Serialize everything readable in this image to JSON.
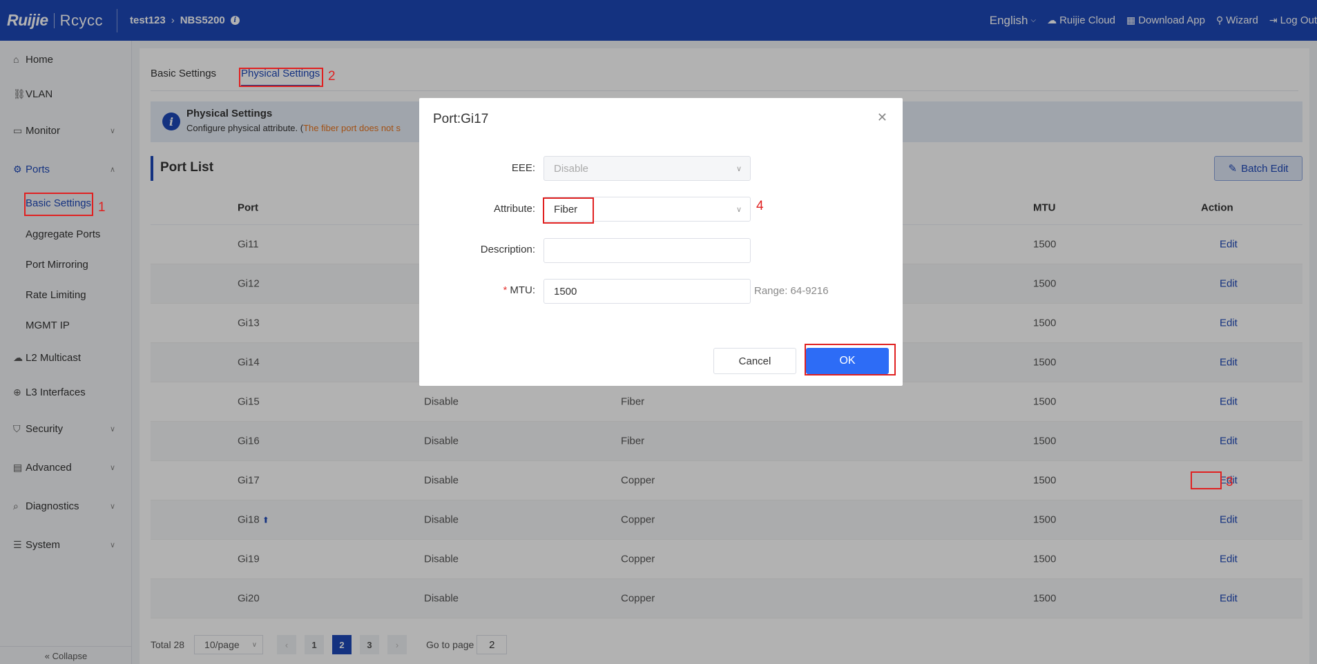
{
  "header": {
    "logo_brand": "Ruijie",
    "logo_sub": "Rcycc",
    "breadcrumb": [
      "test123",
      "NBS5200"
    ],
    "language": "English",
    "links": [
      {
        "icon": "cloud-icon",
        "label": "Ruijie Cloud"
      },
      {
        "icon": "qrcode-icon",
        "label": "Download App"
      },
      {
        "icon": "wizard-icon",
        "label": "Wizard"
      },
      {
        "icon": "logout-icon",
        "label": "Log Out"
      }
    ]
  },
  "sidebar": {
    "items": [
      {
        "label": "Home",
        "icon": "home-icon"
      },
      {
        "label": "VLAN",
        "icon": "vlan-icon"
      },
      {
        "label": "Monitor",
        "icon": "monitor-icon"
      },
      {
        "label": "Ports",
        "icon": "gear-icon"
      },
      {
        "label": "L2 Multicast",
        "icon": "cloud-icon"
      },
      {
        "label": "L3 Interfaces",
        "icon": "globe-icon"
      },
      {
        "label": "Security",
        "icon": "shield-icon"
      },
      {
        "label": "Advanced",
        "icon": "briefcase-icon"
      },
      {
        "label": "Diagnostics",
        "icon": "search-icon"
      },
      {
        "label": "System",
        "icon": "sliders-icon"
      }
    ],
    "ports_sub": [
      "Basic Settings",
      "Aggregate Ports",
      "Port Mirroring",
      "Rate Limiting",
      "MGMT IP"
    ],
    "collapse": "Collapse"
  },
  "main": {
    "tabs": [
      "Basic Settings",
      "Physical Settings"
    ],
    "notice": {
      "title": "Physical Settings",
      "desc_prefix": "Configure physical attribute. (",
      "desc_warn": "The fiber port does not s"
    },
    "section_title": "Port List",
    "batch_edit": "Batch Edit",
    "table": {
      "headers": {
        "port": "Port",
        "mtu": "MTU",
        "action": "Action"
      },
      "rows": [
        {
          "port": "Gi11",
          "eee": "",
          "attr": "",
          "mtu": "1500",
          "action": "Edit"
        },
        {
          "port": "Gi12",
          "eee": "",
          "attr": "",
          "mtu": "1500",
          "action": "Edit"
        },
        {
          "port": "Gi13",
          "eee": "",
          "attr": "",
          "mtu": "1500",
          "action": "Edit"
        },
        {
          "port": "Gi14",
          "eee": "",
          "attr": "",
          "mtu": "1500",
          "action": "Edit"
        },
        {
          "port": "Gi15",
          "eee": "Disable",
          "attr": "Fiber",
          "mtu": "1500",
          "action": "Edit"
        },
        {
          "port": "Gi16",
          "eee": "Disable",
          "attr": "Fiber",
          "mtu": "1500",
          "action": "Edit"
        },
        {
          "port": "Gi17",
          "eee": "Disable",
          "attr": "Copper",
          "mtu": "1500",
          "action": "Edit"
        },
        {
          "port": "Gi18",
          "eee": "Disable",
          "attr": "Copper",
          "mtu": "1500",
          "action": "Edit"
        },
        {
          "port": "Gi19",
          "eee": "Disable",
          "attr": "Copper",
          "mtu": "1500",
          "action": "Edit"
        },
        {
          "port": "Gi20",
          "eee": "Disable",
          "attr": "Copper",
          "mtu": "1500",
          "action": "Edit"
        }
      ]
    },
    "pagination": {
      "total": "Total 28",
      "page_size": "10/page",
      "pages": [
        "1",
        "2",
        "3"
      ],
      "current": "2",
      "goto_label": "Go to page",
      "goto_value": "2"
    }
  },
  "modal": {
    "title": "Port:Gi17",
    "fields": {
      "eee_label": "EEE:",
      "eee_value": "Disable",
      "attribute_label": "Attribute:",
      "attribute_value": "Fiber",
      "description_label": "Description:",
      "description_value": "",
      "mtu_label": "MTU:",
      "mtu_value": "1500",
      "mtu_range": "Range: 64-9216"
    },
    "cancel": "Cancel",
    "ok": "OK"
  },
  "annotations": [
    "1",
    "2",
    "3",
    "4"
  ],
  "colors": {
    "primary": "#1e48b8",
    "ok_button": "#2d6cf6",
    "annotation": "#e02020",
    "warning": "#e8741e"
  }
}
